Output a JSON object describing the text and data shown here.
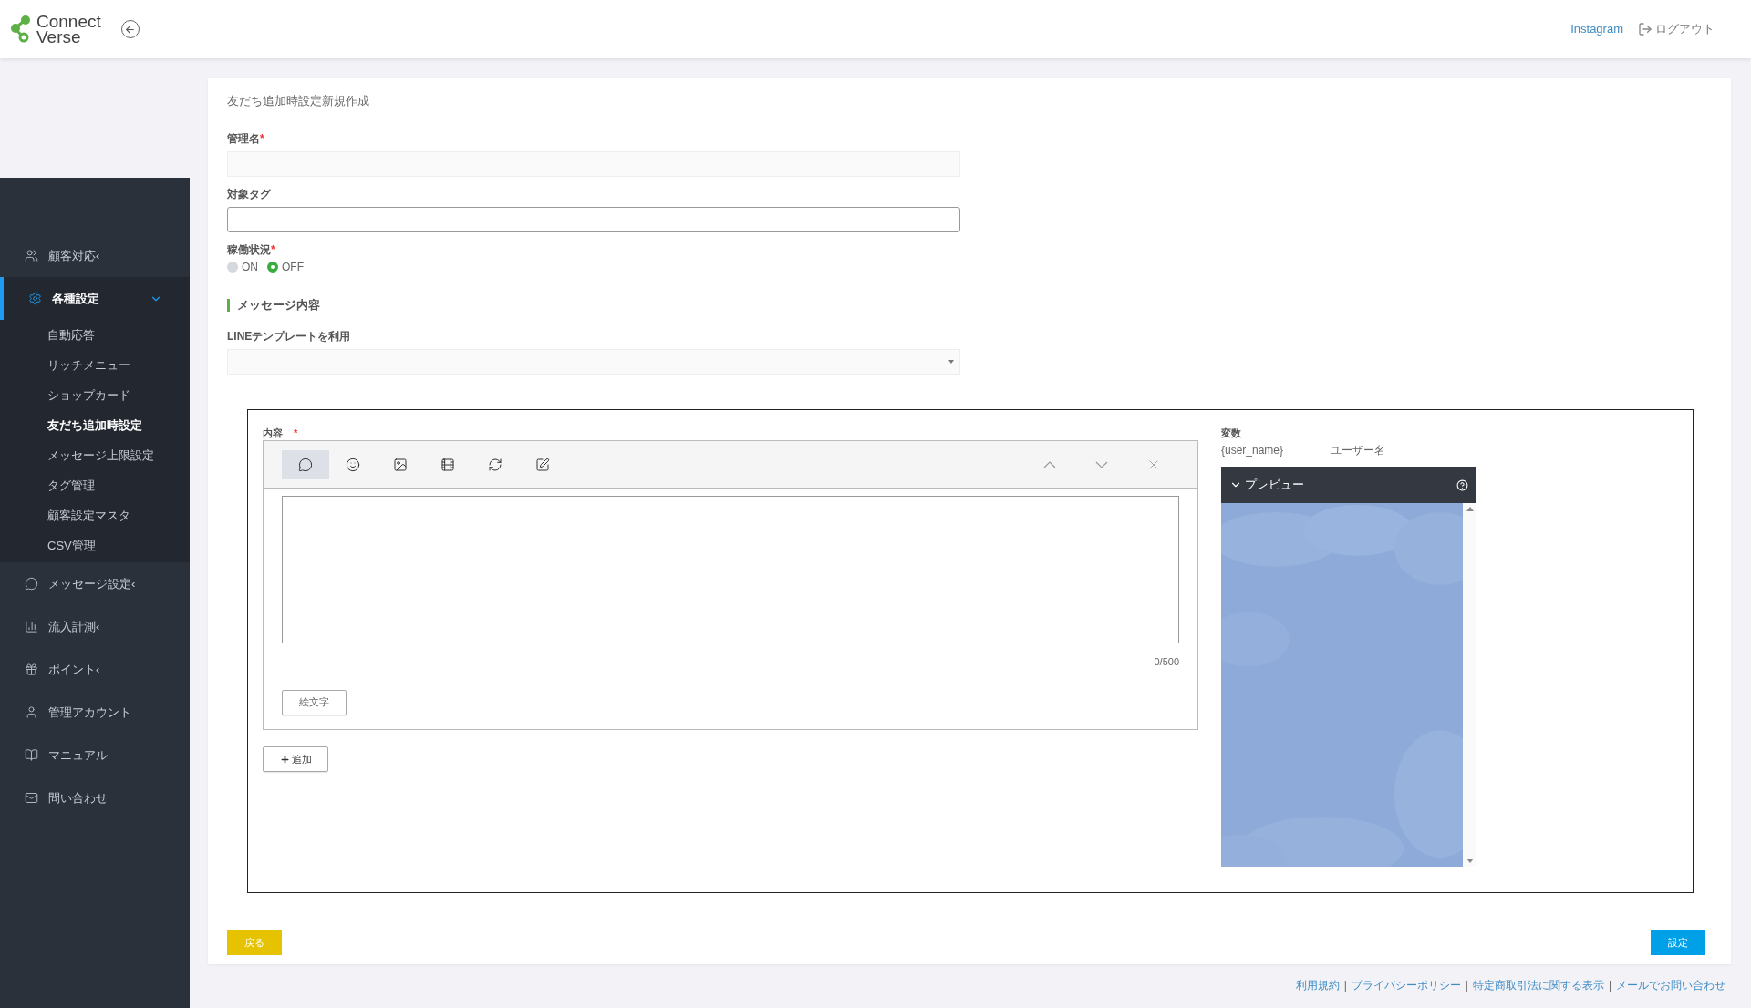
{
  "header": {
    "logo_line1": "Connect",
    "logo_line2": "Verse",
    "links": [
      {
        "kind": "link",
        "label": "Instagram"
      },
      {
        "kind": "logout",
        "label": "ログアウト"
      }
    ]
  },
  "sidebar": {
    "items": [
      {
        "label": "顧客対応",
        "caret": "‹",
        "selected": false
      },
      {
        "label": "各種設定",
        "selected": true,
        "expanded": true,
        "children": [
          {
            "label": "自動応答",
            "selected": false
          },
          {
            "label": "リッチメニュー",
            "selected": false
          },
          {
            "label": "ショップカード",
            "selected": false
          },
          {
            "label": "友だち追加時設定",
            "selected": true
          },
          {
            "label": "メッセージ上限設定",
            "selected": false
          },
          {
            "label": "タグ管理",
            "selected": false
          },
          {
            "label": "顧客設定マスタ",
            "selected": false
          },
          {
            "label": "CSV管理",
            "selected": false
          }
        ]
      },
      {
        "label": "メッセージ設定",
        "caret": "‹",
        "selected": false
      },
      {
        "label": "流入計測",
        "caret": "‹",
        "selected": false
      },
      {
        "label": "ポイント",
        "caret": "‹",
        "selected": false
      },
      {
        "label": "管理アカウント",
        "selected": false
      },
      {
        "label": "マニュアル",
        "selected": false
      },
      {
        "label": "問い合わせ",
        "selected": false
      }
    ]
  },
  "form": {
    "title": "友だち追加時設定新規作成",
    "name_field": {
      "label": "管理名",
      "required": "*"
    },
    "tag_field": {
      "label": "対象タグ"
    },
    "status": {
      "label": "稼働状況",
      "required": "*",
      "options": [
        {
          "label": "ON",
          "selected": false
        },
        {
          "label": "OFF",
          "selected": true
        }
      ]
    },
    "section_title": "メッセージ内容",
    "template": {
      "label": "LINEテンプレートを利用"
    },
    "editor": {
      "label": "内容",
      "required": "*",
      "tools": [
        {
          "selected": true
        },
        {
          "selected": false
        },
        {
          "selected": false
        },
        {
          "selected": false
        },
        {
          "selected": false
        },
        {
          "selected": false
        }
      ],
      "counter": "0/500",
      "emoji_button": "絵文字",
      "add_button": "追加"
    },
    "variables": {
      "label": "変数",
      "rows": [
        {
          "name": "{user_name}",
          "meaning": "ユーザー名"
        }
      ]
    },
    "preview": {
      "title": "プレビュー",
      "expanded": true
    },
    "back_button": "戻る",
    "submit_button": "設定"
  },
  "footer": {
    "links": [
      "利用規約",
      "プライバシーポリシー",
      "特定商取引法に関する表示",
      "メールでお問い合わせ"
    ],
    "separator": "|"
  }
}
